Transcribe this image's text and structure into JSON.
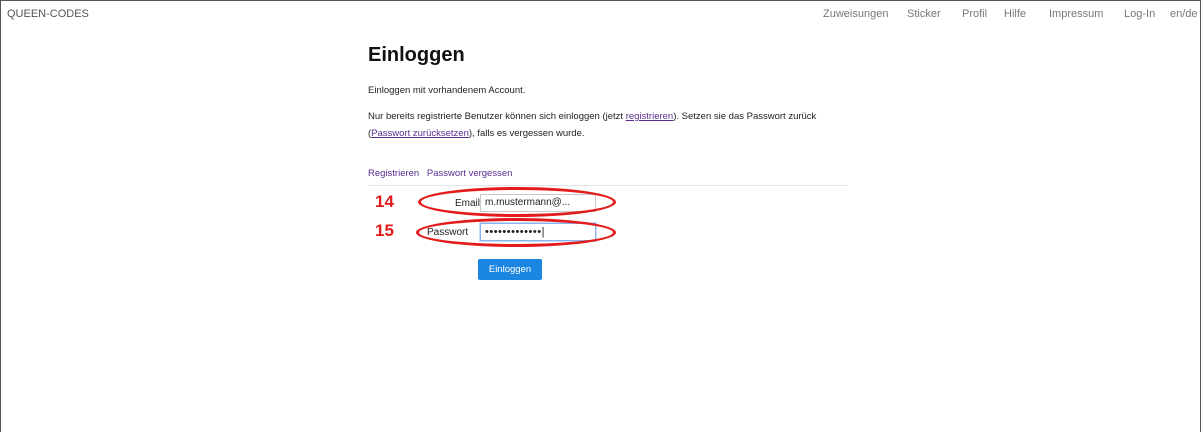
{
  "header": {
    "brand": "QUEEN-CODES",
    "nav": [
      "Zuweisungen",
      "Sticker",
      "Profil",
      "Hilfe",
      "Impressum",
      "Log-In",
      "en/de"
    ]
  },
  "main": {
    "title": "Einloggen",
    "intro": "Einloggen mit vorhandenem Account.",
    "info": {
      "part1": "Nur bereits registrierte Benutzer können sich einloggen (jetzt ",
      "link1": "registrieren",
      "part2": "). Setzen sie das Passwort zurück",
      "part3": "(",
      "link2": "Passwort zurücksetzen",
      "part4": "), falls es vergessen wurde."
    },
    "links": {
      "register": "Registrieren",
      "forgot": "Passwort vergessen"
    },
    "form": {
      "email_label": "Email",
      "email_value": "m.mustermann@...",
      "password_label": "Passwort",
      "password_value": "•••••••••••••|",
      "submit": "Einloggen"
    }
  },
  "annotations": {
    "email_number": "14",
    "password_number": "15",
    "color": "#e31b1b"
  }
}
